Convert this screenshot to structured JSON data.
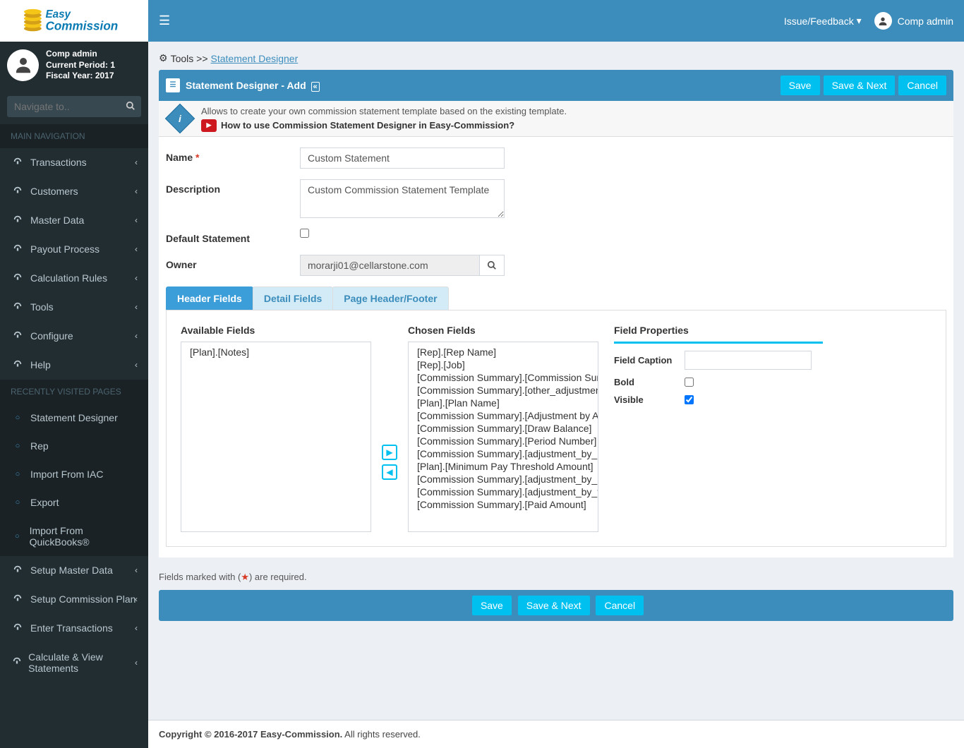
{
  "logo": {
    "brand_top": "Easy",
    "brand_bottom": "Commission"
  },
  "topbar": {
    "issue_feedback": "Issue/Feedback",
    "username": "Comp admin"
  },
  "user_panel": {
    "name": "Comp admin",
    "period": "Current Period: 1",
    "fiscal": "Fiscal Year: 2017"
  },
  "side_search_placeholder": "Navigate to..",
  "main_nav_heading": "MAIN NAVIGATION",
  "nav_items": [
    "Transactions",
    "Customers",
    "Master Data",
    "Payout Process",
    "Calculation Rules",
    "Tools",
    "Configure",
    "Help"
  ],
  "recent_heading": "RECENTLY VISITED PAGES",
  "recent_items": [
    "Statement Designer",
    "Rep",
    "Import From IAC",
    "Export",
    "Import From QuickBooks®"
  ],
  "recent_nav_extra": [
    "Setup Master Data",
    "Setup Commission Plan",
    "Enter Transactions",
    "Calculate & View Statements"
  ],
  "breadcrumb": {
    "root": "Tools",
    "sep": ">>",
    "leaf": "Statement Designer"
  },
  "panel_title": "Statement Designer - Add",
  "buttons": {
    "save": "Save",
    "save_next": "Save & Next",
    "cancel": "Cancel"
  },
  "info": {
    "line1": "Allows to create your own commission statement template based on the existing template.",
    "line2": "How to use Commission Statement Designer in Easy-Commission?"
  },
  "form": {
    "name_label": "Name",
    "name_value": "Custom Statement",
    "desc_label": "Description",
    "desc_value": "Custom Commission Statement Template",
    "default_label": "Default Statement",
    "default_checked": false,
    "owner_label": "Owner",
    "owner_value": "morarji01@cellarstone.com"
  },
  "tabs": [
    "Header Fields",
    "Detail Fields",
    "Page Header/Footer"
  ],
  "active_tab": 0,
  "available_label": "Available Fields",
  "chosen_label": "Chosen Fields",
  "available_fields": [
    "[Plan].[Notes]"
  ],
  "chosen_fields": [
    "[Rep].[Rep Name]",
    "[Rep].[Job]",
    "[Commission Summary].[Commission Summary]",
    "[Commission Summary].[other_adjustment]",
    "[Plan].[Plan Name]",
    "[Commission Summary].[Adjustment by Admin]",
    "[Commission Summary].[Draw Balance]",
    "[Commission Summary].[Period Number]",
    "[Commission Summary].[adjustment_by_rep]",
    "[Plan].[Minimum Pay Threshold Amount]",
    "[Commission Summary].[adjustment_by_mgr]",
    "[Commission Summary].[adjustment_by_fin]",
    "[Commission Summary].[Paid Amount]"
  ],
  "props": {
    "heading": "Field Properties",
    "caption_label": "Field Caption",
    "caption_value": "",
    "bold_label": "Bold",
    "bold_checked": false,
    "visible_label": "Visible",
    "visible_checked": true
  },
  "req_note_prefix": "Fields marked with (",
  "req_note_suffix": ") are required.",
  "copyright_bold": "Copyright © 2016-2017 Easy-Commission.",
  "copyright_rest": " All rights reserved."
}
